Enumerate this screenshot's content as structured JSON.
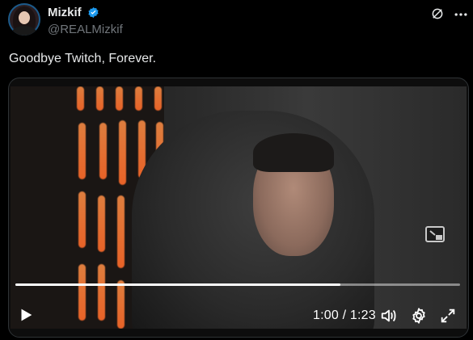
{
  "tweet": {
    "author_name": "Mizkif",
    "author_handle": "@REALMizkif",
    "verified": true,
    "text": "Goodbye Twitch, Forever."
  },
  "video": {
    "time_display": "1:00 / 1:23",
    "progress": 0.73,
    "controls": {
      "play_icon": "play-icon",
      "volume_icon": "volume-icon",
      "settings_icon": "gear-icon",
      "fullscreen_icon": "fullscreen-icon",
      "pip_icon": "picture-in-picture-icon"
    }
  },
  "icons": {
    "grok": "grok-icon",
    "more": "more-icon"
  },
  "colors": {
    "background": "#000000",
    "text": "#e7e9ea",
    "muted": "#71767b",
    "verified": "#1d9bf0"
  }
}
